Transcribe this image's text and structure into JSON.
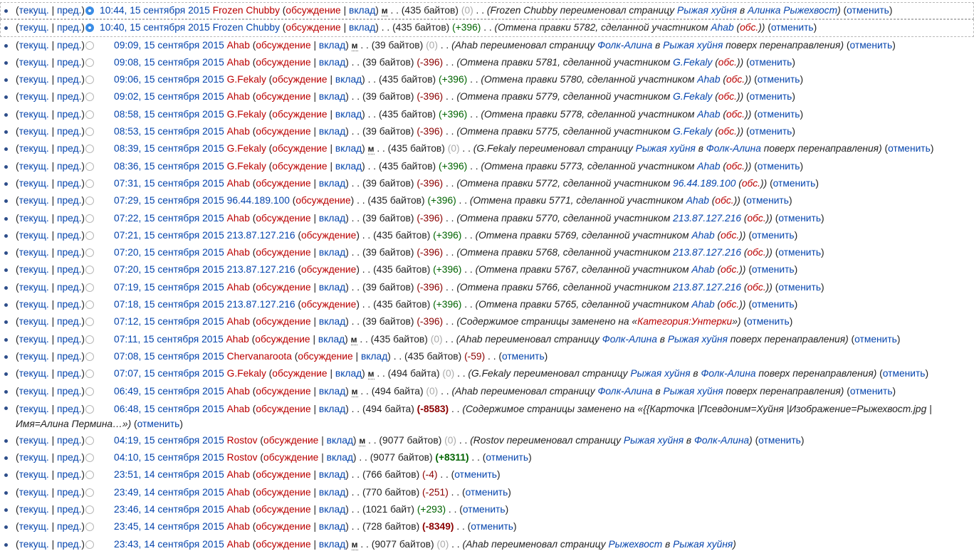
{
  "labels": {
    "cur": "текущ.",
    "prev": "пред.",
    "talk": "обсуждение",
    "contribs": "вклад",
    "minor": "м",
    "undo": "отменить"
  },
  "rows": [
    {
      "date": "10:44, 15 сентября 2015",
      "user": "Frozen Chubby",
      "userNew": true,
      "contribs": true,
      "minor": true,
      "size": "435 байтов",
      "diff": "0",
      "diffType": "null",
      "selected": true,
      "radio": "on",
      "comment": [
        {
          "t": "Frozen Chubby переименовал страницу "
        },
        {
          "t": "Рыжая хуйня",
          "a": true
        },
        {
          "t": " в "
        },
        {
          "t": "Алинка Рыжехвост",
          "a": true
        }
      ],
      "cmtParen": true,
      "undo": true
    },
    {
      "date": "10:40, 15 сентября 2015",
      "user": "Frozen Chubby",
      "userNew": false,
      "contribs": true,
      "minor": false,
      "size": "435 байтов",
      "diff": "+396",
      "diffType": "pos",
      "selected": true,
      "radio": "on",
      "comment": [
        {
          "t": "Отмена правки 5782, сделанной участником "
        },
        {
          "t": "Ahab",
          "a": true
        },
        {
          "t": " ("
        },
        {
          "t": "обс.",
          "n": true
        },
        {
          "t": ")"
        }
      ],
      "cmtParen": true,
      "undo": true
    },
    {
      "date": "09:09, 15 сентября 2015",
      "user": "Ahab",
      "userNew": true,
      "contribs": true,
      "minor": true,
      "size": "39 байтов",
      "diff": "0",
      "diffType": "null",
      "comment": [
        {
          "t": "Ahab переименовал страницу "
        },
        {
          "t": "Фолк-Алина",
          "a": true
        },
        {
          "t": " в "
        },
        {
          "t": "Рыжая хуйня",
          "a": true
        },
        {
          "t": " поверх перенаправления"
        }
      ],
      "cmtParen": true,
      "undo": true
    },
    {
      "date": "09:08, 15 сентября 2015",
      "user": "Ahab",
      "userNew": true,
      "contribs": true,
      "minor": false,
      "size": "39 байтов",
      "diff": "-396",
      "diffType": "neg",
      "comment": [
        {
          "t": "Отмена правки 5781, сделанной участником "
        },
        {
          "t": "G.Fekaly",
          "a": true
        },
        {
          "t": " ("
        },
        {
          "t": "обс.",
          "n": true
        },
        {
          "t": ")"
        }
      ],
      "cmtParen": true,
      "undo": true
    },
    {
      "date": "09:06, 15 сентября 2015",
      "user": "G.Fekaly",
      "userNew": true,
      "contribs": true,
      "minor": false,
      "size": "435 байтов",
      "diff": "+396",
      "diffType": "pos",
      "comment": [
        {
          "t": "Отмена правки 5780, сделанной участником "
        },
        {
          "t": "Ahab",
          "a": true
        },
        {
          "t": " ("
        },
        {
          "t": "обс.",
          "n": true
        },
        {
          "t": ")"
        }
      ],
      "cmtParen": true,
      "undo": true
    },
    {
      "date": "09:02, 15 сентября 2015",
      "user": "Ahab",
      "userNew": true,
      "contribs": true,
      "minor": false,
      "size": "39 байтов",
      "diff": "-396",
      "diffType": "neg",
      "comment": [
        {
          "t": "Отмена правки 5779, сделанной участником "
        },
        {
          "t": "G.Fekaly",
          "a": true
        },
        {
          "t": " ("
        },
        {
          "t": "обс.",
          "n": true
        },
        {
          "t": ")"
        }
      ],
      "cmtParen": true,
      "undo": true
    },
    {
      "date": "08:58, 15 сентября 2015",
      "user": "G.Fekaly",
      "userNew": true,
      "contribs": true,
      "minor": false,
      "size": "435 байтов",
      "diff": "+396",
      "diffType": "pos",
      "comment": [
        {
          "t": "Отмена правки 5778, сделанной участником "
        },
        {
          "t": "Ahab",
          "a": true
        },
        {
          "t": " ("
        },
        {
          "t": "обс.",
          "n": true
        },
        {
          "t": ")"
        }
      ],
      "cmtParen": true,
      "undo": true
    },
    {
      "date": "08:53, 15 сентября 2015",
      "user": "Ahab",
      "userNew": true,
      "contribs": true,
      "minor": false,
      "size": "39 байтов",
      "diff": "-396",
      "diffType": "neg",
      "comment": [
        {
          "t": "Отмена правки 5775, сделанной участником "
        },
        {
          "t": "G.Fekaly",
          "a": true
        },
        {
          "t": " ("
        },
        {
          "t": "обс.",
          "n": true
        },
        {
          "t": ")"
        }
      ],
      "cmtParen": true,
      "undo": true
    },
    {
      "date": "08:39, 15 сентября 2015",
      "user": "G.Fekaly",
      "userNew": true,
      "contribs": true,
      "minor": true,
      "size": "435 байтов",
      "diff": "0",
      "diffType": "null",
      "comment": [
        {
          "t": "G.Fekaly переименовал страницу "
        },
        {
          "t": "Рыжая хуйня",
          "a": true
        },
        {
          "t": " в "
        },
        {
          "t": "Фолк-Алина",
          "a": true
        },
        {
          "t": " поверх перенаправления"
        }
      ],
      "cmtParen": true,
      "undo": true
    },
    {
      "date": "08:36, 15 сентября 2015",
      "user": "G.Fekaly",
      "userNew": true,
      "contribs": true,
      "minor": false,
      "size": "435 байтов",
      "diff": "+396",
      "diffType": "pos",
      "comment": [
        {
          "t": "Отмена правки 5773, сделанной участником "
        },
        {
          "t": "Ahab",
          "a": true
        },
        {
          "t": " ("
        },
        {
          "t": "обс.",
          "n": true
        },
        {
          "t": ")"
        }
      ],
      "cmtParen": true,
      "undo": true
    },
    {
      "date": "07:31, 15 сентября 2015",
      "user": "Ahab",
      "userNew": true,
      "contribs": true,
      "minor": false,
      "size": "39 байтов",
      "diff": "-396",
      "diffType": "neg",
      "comment": [
        {
          "t": "Отмена правки 5772, сделанной участником "
        },
        {
          "t": "96.44.189.100",
          "a": true
        },
        {
          "t": " ("
        },
        {
          "t": "обс.",
          "n": true
        },
        {
          "t": ")"
        }
      ],
      "cmtParen": true,
      "undo": true
    },
    {
      "date": "07:29, 15 сентября 2015",
      "user": "96.44.189.100",
      "userNew": false,
      "contribs": false,
      "minor": false,
      "size": "435 байтов",
      "diff": "+396",
      "diffType": "pos",
      "comment": [
        {
          "t": "Отмена правки 5771, сделанной участником "
        },
        {
          "t": "Ahab",
          "a": true
        },
        {
          "t": " ("
        },
        {
          "t": "обс.",
          "n": true
        },
        {
          "t": ")"
        }
      ],
      "cmtParen": true,
      "undo": true
    },
    {
      "date": "07:22, 15 сентября 2015",
      "user": "Ahab",
      "userNew": true,
      "contribs": true,
      "minor": false,
      "size": "39 байтов",
      "diff": "-396",
      "diffType": "neg",
      "comment": [
        {
          "t": "Отмена правки 5770, сделанной участником "
        },
        {
          "t": "213.87.127.216",
          "a": true
        },
        {
          "t": " ("
        },
        {
          "t": "обс.",
          "n": true
        },
        {
          "t": ")"
        }
      ],
      "cmtParen": true,
      "undo": true
    },
    {
      "date": "07:21, 15 сентября 2015",
      "user": "213.87.127.216",
      "userNew": false,
      "contribs": false,
      "minor": false,
      "size": "435 байтов",
      "diff": "+396",
      "diffType": "pos",
      "comment": [
        {
          "t": "Отмена правки 5769, сделанной участником "
        },
        {
          "t": "Ahab",
          "a": true
        },
        {
          "t": " ("
        },
        {
          "t": "обс.",
          "n": true
        },
        {
          "t": ")"
        }
      ],
      "cmtParen": true,
      "undo": true
    },
    {
      "date": "07:20, 15 сентября 2015",
      "user": "Ahab",
      "userNew": true,
      "contribs": true,
      "minor": false,
      "size": "39 байтов",
      "diff": "-396",
      "diffType": "neg",
      "comment": [
        {
          "t": "Отмена правки 5768, сделанной участником "
        },
        {
          "t": "213.87.127.216",
          "a": true
        },
        {
          "t": " ("
        },
        {
          "t": "обс.",
          "n": true
        },
        {
          "t": ")"
        }
      ],
      "cmtParen": true,
      "undo": true
    },
    {
      "date": "07:20, 15 сентября 2015",
      "user": "213.87.127.216",
      "userNew": false,
      "contribs": false,
      "minor": false,
      "size": "435 байтов",
      "diff": "+396",
      "diffType": "pos",
      "comment": [
        {
          "t": "Отмена правки 5767, сделанной участником "
        },
        {
          "t": "Ahab",
          "a": true
        },
        {
          "t": " ("
        },
        {
          "t": "обс.",
          "n": true
        },
        {
          "t": ")"
        }
      ],
      "cmtParen": true,
      "undo": true
    },
    {
      "date": "07:19, 15 сентября 2015",
      "user": "Ahab",
      "userNew": true,
      "contribs": true,
      "minor": false,
      "size": "39 байтов",
      "diff": "-396",
      "diffType": "neg",
      "comment": [
        {
          "t": "Отмена правки 5766, сделанной участником "
        },
        {
          "t": "213.87.127.216",
          "a": true
        },
        {
          "t": " ("
        },
        {
          "t": "обс.",
          "n": true
        },
        {
          "t": ")"
        }
      ],
      "cmtParen": true,
      "undo": true
    },
    {
      "date": "07:18, 15 сентября 2015",
      "user": "213.87.127.216",
      "userNew": false,
      "contribs": false,
      "minor": false,
      "size": "435 байтов",
      "diff": "+396",
      "diffType": "pos",
      "comment": [
        {
          "t": "Отмена правки 5765, сделанной участником "
        },
        {
          "t": "Ahab",
          "a": true
        },
        {
          "t": " ("
        },
        {
          "t": "обс.",
          "n": true
        },
        {
          "t": ")"
        }
      ],
      "cmtParen": true,
      "undo": true
    },
    {
      "date": "07:12, 15 сентября 2015",
      "user": "Ahab",
      "userNew": true,
      "contribs": true,
      "minor": false,
      "size": "39 байтов",
      "diff": "-396",
      "diffType": "neg",
      "comment": [
        {
          "t": "Содержимое страницы заменено на «"
        },
        {
          "t": "Категория:Унтерки",
          "n": true
        },
        {
          "t": "»"
        }
      ],
      "cmtParen": true,
      "undo": true
    },
    {
      "date": "07:11, 15 сентября 2015",
      "user": "Ahab",
      "userNew": true,
      "contribs": true,
      "minor": true,
      "size": "435 байтов",
      "diff": "0",
      "diffType": "null",
      "comment": [
        {
          "t": "Ahab переименовал страницу "
        },
        {
          "t": "Фолк-Алина",
          "a": true
        },
        {
          "t": " в "
        },
        {
          "t": "Рыжая хуйня",
          "a": true
        },
        {
          "t": " поверх перенаправления"
        }
      ],
      "cmtParen": true,
      "undo": true
    },
    {
      "date": "07:08, 15 сентября 2015",
      "user": "Chervanaroota",
      "userNew": true,
      "contribs": true,
      "minor": false,
      "size": "435 байтов",
      "diff": "-59",
      "diffType": "neg",
      "comment": [],
      "cmtParen": false,
      "undo": true
    },
    {
      "date": "07:07, 15 сентября 2015",
      "user": "G.Fekaly",
      "userNew": true,
      "contribs": true,
      "minor": true,
      "size": "494 байта",
      "diff": "0",
      "diffType": "null",
      "comment": [
        {
          "t": "G.Fekaly переименовал страницу "
        },
        {
          "t": "Рыжая хуйня",
          "a": true
        },
        {
          "t": " в "
        },
        {
          "t": "Фолк-Алина",
          "a": true
        },
        {
          "t": " поверх перенаправления"
        }
      ],
      "cmtParen": true,
      "undo": true
    },
    {
      "date": "06:49, 15 сентября 2015",
      "user": "Ahab",
      "userNew": true,
      "contribs": true,
      "minor": true,
      "size": "494 байта",
      "diff": "0",
      "diffType": "null",
      "comment": [
        {
          "t": "Ahab переименовал страницу "
        },
        {
          "t": "Фолк-Алина",
          "a": true
        },
        {
          "t": " в "
        },
        {
          "t": "Рыжая хуйня",
          "a": true
        },
        {
          "t": " поверх перенаправления"
        }
      ],
      "cmtParen": true,
      "undo": true
    },
    {
      "date": "06:48, 15 сентября 2015",
      "user": "Ahab",
      "userNew": true,
      "contribs": true,
      "minor": false,
      "size": "494 байта",
      "diff": "-8583",
      "diffType": "neg",
      "big": true,
      "wrap": true,
      "comment": [
        {
          "t": "Содержимое страницы заменено на «{{Карточка |Псевдоним=Хуйня |Изображение=Рыжехвост.jpg | Имя=Алина Пермина…»"
        }
      ],
      "cmtParen": true,
      "undo": true
    },
    {
      "date": "04:19, 15 сентября 2015",
      "user": "Rostov",
      "userNew": true,
      "contribs": true,
      "minor": true,
      "size": "9077 байтов",
      "diff": "0",
      "diffType": "null",
      "comment": [
        {
          "t": "Rostov переименовал страницу "
        },
        {
          "t": "Рыжая хуйня",
          "a": true
        },
        {
          "t": " в "
        },
        {
          "t": "Фолк-Алина",
          "a": true
        }
      ],
      "cmtParen": true,
      "undo": true
    },
    {
      "date": "04:10, 15 сентября 2015",
      "user": "Rostov",
      "userNew": true,
      "contribs": true,
      "minor": false,
      "size": "9077 байтов",
      "diff": "+8311",
      "diffType": "pos",
      "big": true,
      "comment": [],
      "cmtParen": false,
      "undo": true
    },
    {
      "date": "23:51, 14 сентября 2015",
      "user": "Ahab",
      "userNew": true,
      "contribs": true,
      "minor": false,
      "size": "766 байтов",
      "diff": "-4",
      "diffType": "neg",
      "comment": [],
      "cmtParen": false,
      "undo": true
    },
    {
      "date": "23:49, 14 сентября 2015",
      "user": "Ahab",
      "userNew": true,
      "contribs": true,
      "minor": false,
      "size": "770 байтов",
      "diff": "-251",
      "diffType": "neg",
      "comment": [],
      "cmtParen": false,
      "undo": true
    },
    {
      "date": "23:46, 14 сентября 2015",
      "user": "Ahab",
      "userNew": true,
      "contribs": true,
      "minor": false,
      "size": "1021 байт",
      "diff": "+293",
      "diffType": "pos",
      "comment": [],
      "cmtParen": false,
      "undo": true
    },
    {
      "date": "23:45, 14 сентября 2015",
      "user": "Ahab",
      "userNew": true,
      "contribs": true,
      "minor": false,
      "size": "728 байтов",
      "diff": "-8349",
      "diffType": "neg",
      "big": true,
      "comment": [],
      "cmtParen": false,
      "undo": true
    },
    {
      "date": "23:43, 14 сентября 2015",
      "user": "Ahab",
      "userNew": true,
      "contribs": true,
      "minor": true,
      "size": "9077 байтов",
      "diff": "0",
      "diffType": "null",
      "comment": [
        {
          "t": "Ahab переименовал страницу "
        },
        {
          "t": "Рыжехвост",
          "a": true
        },
        {
          "t": " в "
        },
        {
          "t": "Рыжая хуйня",
          "a": true
        }
      ],
      "cmtParen": true,
      "undo": false
    }
  ]
}
